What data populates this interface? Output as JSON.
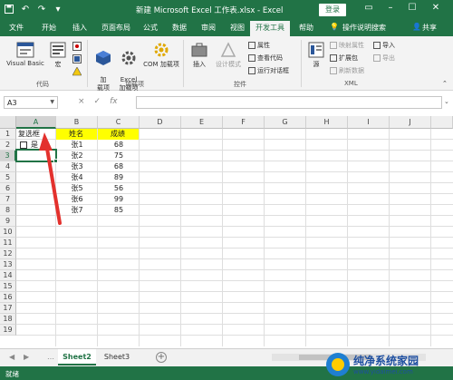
{
  "window": {
    "title": "新建 Microsoft Excel 工作表.xlsx - Excel",
    "login_label": "登录"
  },
  "ribbon_tabs": [
    "文件",
    "开始",
    "插入",
    "页面布局",
    "公式",
    "数据",
    "审阅",
    "视图",
    "开发工具",
    "帮助"
  ],
  "tell_me": "操作说明搜索",
  "share_label": "共享",
  "ribbon": {
    "code": {
      "visual_basic": "Visual Basic",
      "macro": "宏",
      "group_label": "代码"
    },
    "addins": {
      "add": "加\n载项",
      "excel_addins": "Excel\n加载项",
      "com_addins": "COM 加载项",
      "group_label": "加载项"
    },
    "controls": {
      "insert": "插入",
      "design_mode": "设计模式",
      "properties": "属性",
      "view_code": "查看代码",
      "run_dialog": "运行对话框",
      "group_label": "控件"
    },
    "xml": {
      "source": "源",
      "map_props": "映射属性",
      "expansion_packs": "扩展包",
      "refresh_data": "刷新数据",
      "import": "导入",
      "export": "导出",
      "group_label": "XML"
    }
  },
  "formula_bar": {
    "name_box": "A3",
    "cancel_icon": "×",
    "enter_icon": "✓",
    "fx_label": "fx",
    "value": ""
  },
  "columns": [
    "A",
    "B",
    "C",
    "D",
    "E",
    "F",
    "G",
    "H",
    "I",
    "J"
  ],
  "rows": [
    "1",
    "2",
    "3",
    "4",
    "5",
    "6",
    "7",
    "8",
    "9",
    "10",
    "11",
    "12",
    "13",
    "14",
    "15",
    "16",
    "17",
    "18",
    "19"
  ],
  "cells": {
    "A1": "复选框",
    "B1": "姓名",
    "C1": "成绩",
    "checkbox_label": "是",
    "names": [
      "张1",
      "张2",
      "张3",
      "张4",
      "张5",
      "张6",
      "张7"
    ],
    "scores": [
      "68",
      "75",
      "68",
      "89",
      "56",
      "99",
      "85"
    ]
  },
  "highlight_color": "#ffff00",
  "accent_color": "#217346",
  "sheets": [
    "Sheet2",
    "Sheet3"
  ],
  "active_sheet": "Sheet2",
  "add_sheet": "+",
  "status": "就绪",
  "watermark": {
    "name": "纯净系统家园",
    "url": "www.yidaimei.com"
  }
}
